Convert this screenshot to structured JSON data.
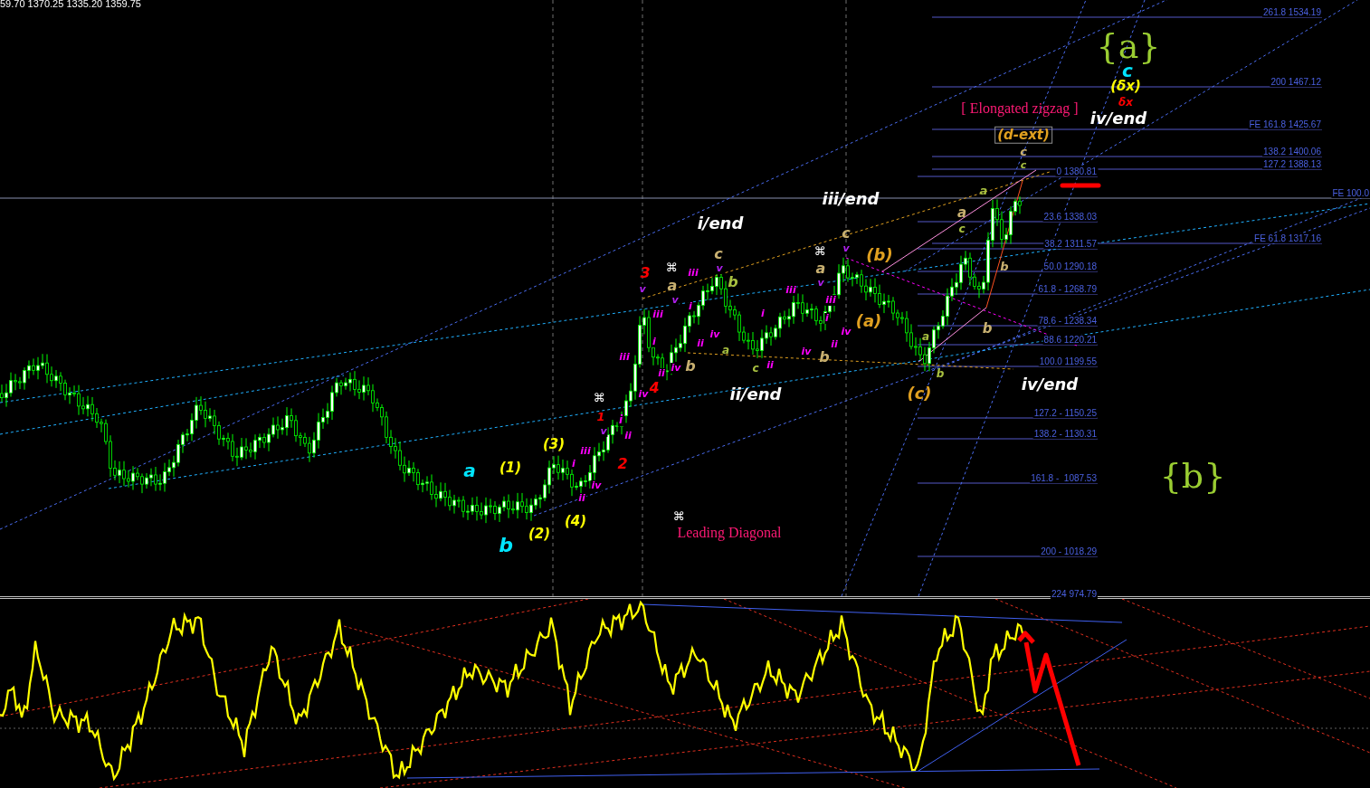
{
  "header": {
    "ohlc": "59.70 1370.25 1335.20 1359.75"
  },
  "fibonacci_levels": [
    {
      "label": "261.8 1534.19"
    },
    {
      "label": "200 1467.12"
    },
    {
      "label": "FE 161.8 1425.67"
    },
    {
      "label": "138.2 1400.06"
    },
    {
      "label": "127.2 1388.13"
    },
    {
      "label": "0 1380.81"
    },
    {
      "label": "FE 100.0"
    },
    {
      "label": "23.6 1338.03"
    },
    {
      "label": "FE 61.8 1317.16"
    },
    {
      "label": "38.2 1311.57"
    },
    {
      "label": "50.0 1290.18"
    },
    {
      "label": "61.8 - 1268.79"
    },
    {
      "label": "78.6 - 1238.34"
    },
    {
      "label": "88.6 1220.21"
    },
    {
      "label": "100.0 1199.55"
    },
    {
      "label": "127.2 - 1150.25"
    },
    {
      "label": "138.2 - 1130.31"
    },
    {
      "label": "161.8 -  1087.53"
    },
    {
      "label": "200 - 1018.29"
    },
    {
      "label": "224 974.79"
    }
  ],
  "labels": [
    {
      "text": "{a}",
      "color": "#9acd32",
      "kind": "brace"
    },
    {
      "text": "c",
      "color": "#00e5ff",
      "kind": "wave"
    },
    {
      "text": "(δx)",
      "color": "#ffff00",
      "kind": "wave"
    },
    {
      "text": "δx",
      "color": "#ff0000",
      "kind": "wave"
    },
    {
      "text": "iv/end",
      "color": "#ffffff",
      "kind": "wave"
    },
    {
      "text": "[ Elongated zigzag ]",
      "color": "#ff1a75",
      "kind": "note"
    },
    {
      "text": "(d-ext)",
      "color": "#e0a020",
      "kind": "boxed"
    },
    {
      "text": "c",
      "color": "#c8b070",
      "kind": "wave"
    },
    {
      "text": "c",
      "color": "#a8c040",
      "kind": "wave"
    },
    {
      "text": "iii/end",
      "color": "#ffffff",
      "kind": "wave"
    },
    {
      "text": "i/end",
      "color": "#ffffff",
      "kind": "wave"
    },
    {
      "text": "⌘",
      "color": "#ffffff",
      "kind": "symbol"
    },
    {
      "text": "⌘",
      "color": "#ffffff",
      "kind": "symbol"
    },
    {
      "text": "⌘",
      "color": "#ffffff",
      "kind": "symbol"
    },
    {
      "text": "⌘",
      "color": "#ffffff",
      "kind": "symbol"
    },
    {
      "text": "3",
      "color": "#ff0000",
      "kind": "wave"
    },
    {
      "text": "4",
      "color": "#ff0000",
      "kind": "wave"
    },
    {
      "text": "1",
      "color": "#ff0000",
      "kind": "wave"
    },
    {
      "text": "2",
      "color": "#ff0000",
      "kind": "wave"
    },
    {
      "text": "a",
      "color": "#c8b070",
      "kind": "wave"
    },
    {
      "text": "b",
      "color": "#c8b070",
      "kind": "wave"
    },
    {
      "text": "c",
      "color": "#c8b070",
      "kind": "wave"
    },
    {
      "text": "b",
      "color": "#a8c040",
      "kind": "wave"
    },
    {
      "text": "a",
      "color": "#a8c040",
      "kind": "wave"
    },
    {
      "text": "c",
      "color": "#a8c040",
      "kind": "wave"
    },
    {
      "text": "a",
      "color": "#c8b070",
      "kind": "wave"
    },
    {
      "text": "c",
      "color": "#c8b070",
      "kind": "wave"
    },
    {
      "text": "b",
      "color": "#c8b070",
      "kind": "wave"
    },
    {
      "text": "(b)",
      "color": "#e0a020",
      "kind": "wave"
    },
    {
      "text": "(a)",
      "color": "#e0a020",
      "kind": "wave"
    },
    {
      "text": "(c)",
      "color": "#e0a020",
      "kind": "wave"
    },
    {
      "text": "a",
      "color": "#a8c040",
      "kind": "wave"
    },
    {
      "text": "a",
      "color": "#c8b070",
      "kind": "wave"
    },
    {
      "text": "c",
      "color": "#a8c040",
      "kind": "wave"
    },
    {
      "text": "b",
      "color": "#c8b070",
      "kind": "wave"
    },
    {
      "text": "b",
      "color": "#c8b070",
      "kind": "wave"
    },
    {
      "text": "a",
      "color": "#a8c040",
      "kind": "wave"
    },
    {
      "text": "b",
      "color": "#a8c040",
      "kind": "wave"
    },
    {
      "text": "ii/end",
      "color": "#ffffff",
      "kind": "wave"
    },
    {
      "text": "iv/end",
      "color": "#ffffff",
      "kind": "wave"
    },
    {
      "text": "a",
      "color": "#00e5ff",
      "kind": "wave"
    },
    {
      "text": "b",
      "color": "#00e5ff",
      "kind": "wave"
    },
    {
      "text": "(1)",
      "color": "#ffff00",
      "kind": "wave"
    },
    {
      "text": "(2)",
      "color": "#ffff00",
      "kind": "wave"
    },
    {
      "text": "(3)",
      "color": "#ffff00",
      "kind": "wave"
    },
    {
      "text": "(4)",
      "color": "#ffff00",
      "kind": "wave"
    },
    {
      "text": "{b}",
      "color": "#9acd32",
      "kind": "brace"
    },
    {
      "text": "Leading Diagonal",
      "color": "#ff1a75",
      "kind": "note"
    },
    {
      "text": "v",
      "color": "#b020f0",
      "kind": "small"
    },
    {
      "text": "iii",
      "color": "#ff00ff",
      "kind": "small"
    },
    {
      "text": "v",
      "color": "#b020f0",
      "kind": "small"
    },
    {
      "text": "v",
      "color": "#b020f0",
      "kind": "small"
    },
    {
      "text": "iii",
      "color": "#ff00ff",
      "kind": "small"
    },
    {
      "text": "v",
      "color": "#b020f0",
      "kind": "small"
    },
    {
      "text": "v",
      "color": "#b020f0",
      "kind": "small"
    },
    {
      "text": "i",
      "color": "#ff00ff",
      "kind": "small"
    },
    {
      "text": "iii",
      "color": "#ff00ff",
      "kind": "small"
    },
    {
      "text": "iii",
      "color": "#ff00ff",
      "kind": "small"
    },
    {
      "text": "i",
      "color": "#ff00ff",
      "kind": "small"
    },
    {
      "text": "i",
      "color": "#ff00ff",
      "kind": "small"
    },
    {
      "text": "iv",
      "color": "#ff00ff",
      "kind": "small"
    },
    {
      "text": "iv",
      "color": "#ff00ff",
      "kind": "small"
    },
    {
      "text": "i",
      "color": "#ff00ff",
      "kind": "small"
    },
    {
      "text": "ii",
      "color": "#ff00ff",
      "kind": "small"
    },
    {
      "text": "ii",
      "color": "#ff00ff",
      "kind": "small"
    },
    {
      "text": "iii",
      "color": "#ff00ff",
      "kind": "small"
    },
    {
      "text": "iv",
      "color": "#ff00ff",
      "kind": "small"
    },
    {
      "text": "ii",
      "color": "#ff00ff",
      "kind": "small"
    },
    {
      "text": "iv",
      "color": "#ff00ff",
      "kind": "small"
    },
    {
      "text": "ii",
      "color": "#ff00ff",
      "kind": "small"
    },
    {
      "text": "iv",
      "color": "#ff00ff",
      "kind": "small"
    },
    {
      "text": "i",
      "color": "#ff00ff",
      "kind": "small"
    },
    {
      "text": "v",
      "color": "#b020f0",
      "kind": "small"
    },
    {
      "text": "ii",
      "color": "#ff00ff",
      "kind": "small"
    },
    {
      "text": "iii",
      "color": "#ff00ff",
      "kind": "small"
    },
    {
      "text": "i",
      "color": "#ff00ff",
      "kind": "small"
    },
    {
      "text": "iv",
      "color": "#ff00ff",
      "kind": "small"
    },
    {
      "text": "ii",
      "color": "#ff00ff",
      "kind": "small"
    }
  ]
}
